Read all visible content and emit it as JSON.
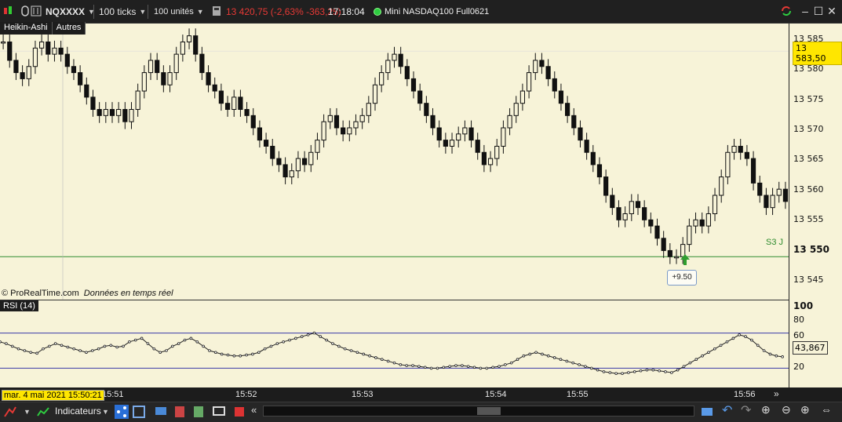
{
  "toolbar": {
    "symbol": "NQXXXX",
    "ticks": "100 ticks",
    "units": "100 unités",
    "price_change": "13 420,75 (-2,63% -363,25)",
    "time": "17:18:04",
    "instrument": "Mini NASDAQ100 Full0621"
  },
  "tabs": [
    "Heikin-Ashi",
    "Autres"
  ],
  "credit": {
    "brand": "© ProRealTime.com",
    "note": "Données en temps réel"
  },
  "price_axis": {
    "labels": [
      "13 585",
      "13 580",
      "13 575",
      "13 570",
      "13 565",
      "13 560",
      "13 555",
      "13 550",
      "13 545"
    ],
    "current": "13 583,50",
    "s3_label": "S3 J",
    "marker": "+9.50"
  },
  "rsi": {
    "label": "RSI (14)",
    "axis": [
      "100",
      "80",
      "60",
      "40",
      "20"
    ],
    "value": "43,867"
  },
  "time_axis": {
    "date": "mar. 4 mai 2021 15:50:21",
    "labels": [
      "15:51",
      "15:52",
      "15:53",
      "15:54",
      "15:55",
      "15:56"
    ],
    "scroll": "»"
  },
  "bottom": {
    "indicators": "Indicateurs"
  },
  "colors": {
    "chart_bg": "#f7f3d8",
    "s3_line": "#2e8b2e",
    "rsi_band": "#3a3aa8",
    "price_flag": "#ffe600",
    "down": "#e53935"
  },
  "chart_data": [
    {
      "type": "candlestick",
      "title": "Heikin-Ashi NQXXXX 100 ticks",
      "ylim": [
        13543,
        13588
      ],
      "series": [
        {
          "name": "Heikin-Ashi",
          "values": [
            13585,
            13582,
            13580,
            13579,
            13581,
            13584,
            13585,
            13583,
            13584,
            13583,
            13581,
            13580,
            13578,
            13576,
            13574,
            13573,
            13574,
            13573,
            13574,
            13572,
            13574,
            13577,
            13580,
            13582,
            13580,
            13578,
            13580,
            13583,
            13585,
            13586,
            13583,
            13580,
            13578,
            13577,
            13575,
            13574,
            13576,
            13574,
            13573,
            13571,
            13569,
            13568,
            13566,
            13565,
            13563,
            13564,
            13566,
            13565,
            13567,
            13569,
            13572,
            13573,
            13571,
            13570,
            13571,
            13572,
            13573,
            13575,
            13578,
            13580,
            13582,
            13583,
            13581,
            13579,
            13577,
            13575,
            13573,
            13571,
            13569,
            13568,
            13569,
            13570,
            13571,
            13569,
            13567,
            13565,
            13566,
            13568,
            13571,
            13573,
            13575,
            13577,
            13580,
            13582,
            13581,
            13579,
            13577,
            13575,
            13573,
            13571,
            13569,
            13567,
            13565,
            13563,
            13560,
            13558,
            13556,
            13557,
            13559,
            13558,
            13556,
            13555,
            13553,
            13551,
            13550,
            13550,
            13552,
            13555,
            13556,
            13555,
            13557,
            13560,
            13563,
            13567,
            13568,
            13567,
            13566,
            13562,
            13560,
            13558,
            13560,
            13561,
            13559
          ]
        }
      ]
    },
    {
      "type": "line",
      "title": "RSI (14)",
      "ylim": [
        0,
        100
      ],
      "series": [
        {
          "name": "RSI (14)",
          "values": [
            60,
            58,
            55,
            52,
            50,
            48,
            47,
            52,
            55,
            58,
            56,
            54,
            52,
            50,
            48,
            50,
            52,
            55,
            56,
            54,
            55,
            60,
            62,
            64,
            58,
            52,
            48,
            50,
            55,
            58,
            62,
            64,
            60,
            55,
            50,
            48,
            46,
            45,
            44,
            44,
            45,
            46,
            48,
            52,
            55,
            58,
            60,
            62,
            64,
            66,
            68,
            70,
            66,
            62,
            58,
            55,
            52,
            50,
            48,
            46,
            44,
            42,
            40,
            38,
            36,
            34,
            33,
            33,
            32,
            31,
            30,
            30,
            31,
            32,
            33,
            33,
            32,
            31,
            30,
            30,
            31,
            32,
            34,
            36,
            40,
            44,
            46,
            48,
            46,
            44,
            42,
            40,
            38,
            36,
            34,
            32,
            30,
            28,
            26,
            25,
            24,
            24,
            25,
            26,
            27,
            28,
            28,
            27,
            26,
            25,
            28,
            32,
            36,
            40,
            44,
            48,
            52,
            56,
            60,
            64,
            68,
            66,
            62,
            56,
            50,
            46,
            44,
            43
          ]
        }
      ]
    }
  ]
}
